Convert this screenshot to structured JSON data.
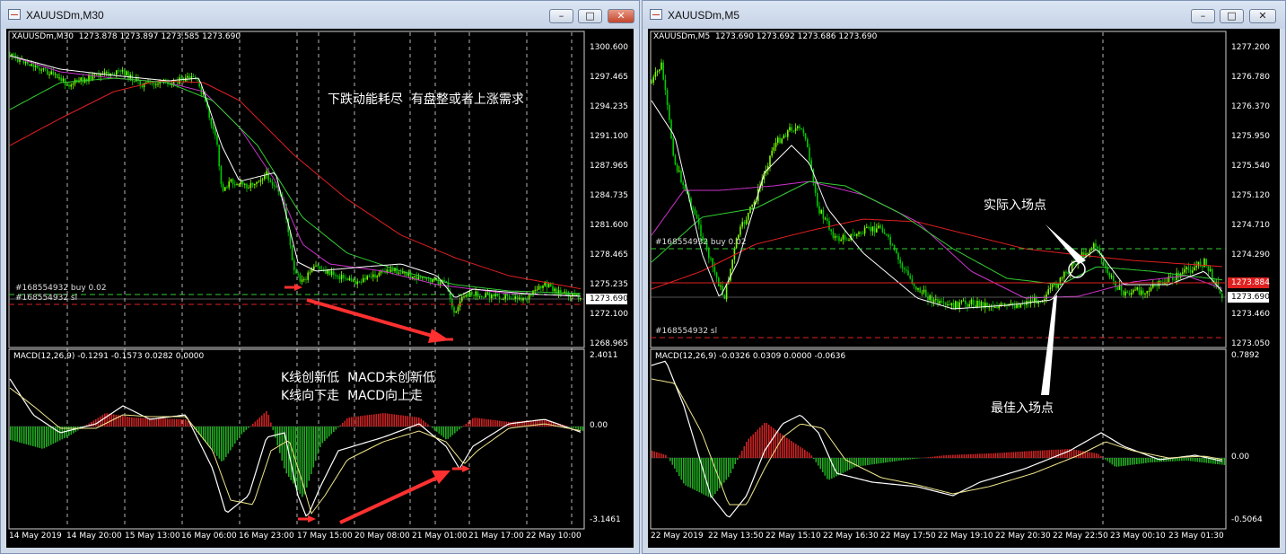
{
  "windows": [
    {
      "title": "XAUUSDm,M30",
      "header": "XAUUSDm,M30  1273.878 1273.897 1273.585 1273.690",
      "price_labels": [
        "1300.600",
        "1297.465",
        "1294.235",
        "1291.100",
        "1287.965",
        "1284.735",
        "1281.600",
        "1278.465",
        "1275.235",
        "1273.690",
        "1272.100",
        "1268.965"
      ],
      "current_price": "1273.690",
      "order_buy": "#168554932 buy 0.02",
      "order_sl": "#168554932 sl",
      "annotation_main": "下跌动能耗尽  有盘整或者上涨需求",
      "macd_header": "MACD(12,26,9) -0.1291 -0.1573 0.0282 0.0000",
      "macd_labels": [
        "2.4011",
        "0.00",
        "-3.1461"
      ],
      "annotation_macd_1": "K线创新低  MACD未创新低",
      "annotation_macd_2": "K线向下走  MACD向上走",
      "time_labels": [
        "14 May 2019",
        "14 May 20:00",
        "15 May 13:00",
        "16 May 06:00",
        "16 May 23:00",
        "17 May 15:00",
        "20 May 08:00",
        "21 May 01:00",
        "21 May 17:00",
        "22 May 10:00"
      ]
    },
    {
      "title": "XAUUSDm,M5",
      "header": "XAUUSDm,M5  1273.690 1273.692 1273.686 1273.690",
      "price_labels": [
        "1277.200",
        "1276.780",
        "1276.370",
        "1275.950",
        "1275.540",
        "1275.120",
        "1274.710",
        "1274.290",
        "1273.884",
        "1273.690",
        "1273.460",
        "1273.050"
      ],
      "current_price": "1273.690",
      "red_price": "1273.884",
      "order_buy": "#168554932 buy 0.02",
      "order_sl": "#168554932 sl",
      "annotation_entry_actual": "实际入场点",
      "annotation_entry_best": "最佳入场点",
      "macd_header": "MACD(12,26,9) -0.0326 0.0309 0.0000 -0.0636",
      "macd_labels": [
        "0.7892",
        "0.00",
        "-0.5064"
      ],
      "time_labels": [
        "22 May 2019",
        "22 May 13:50",
        "22 May 15:10",
        "22 May 16:30",
        "22 May 17:50",
        "22 May 19:10",
        "22 May 20:30",
        "22 May 22:50",
        "23 May 00:10",
        "23 May 01:30"
      ]
    }
  ],
  "window_controls": {
    "minimize": "–",
    "maximize": "□",
    "close": "✕"
  },
  "colors": {
    "bull": "#7cfc00",
    "bear": "#00c800",
    "ma_red": "#e02020",
    "ma_magenta": "#cc33cc",
    "ma_green": "#33cc33",
    "macd_pos": "#cc2222",
    "macd_neg": "#22aa22",
    "arrow": "#ff3030"
  }
}
